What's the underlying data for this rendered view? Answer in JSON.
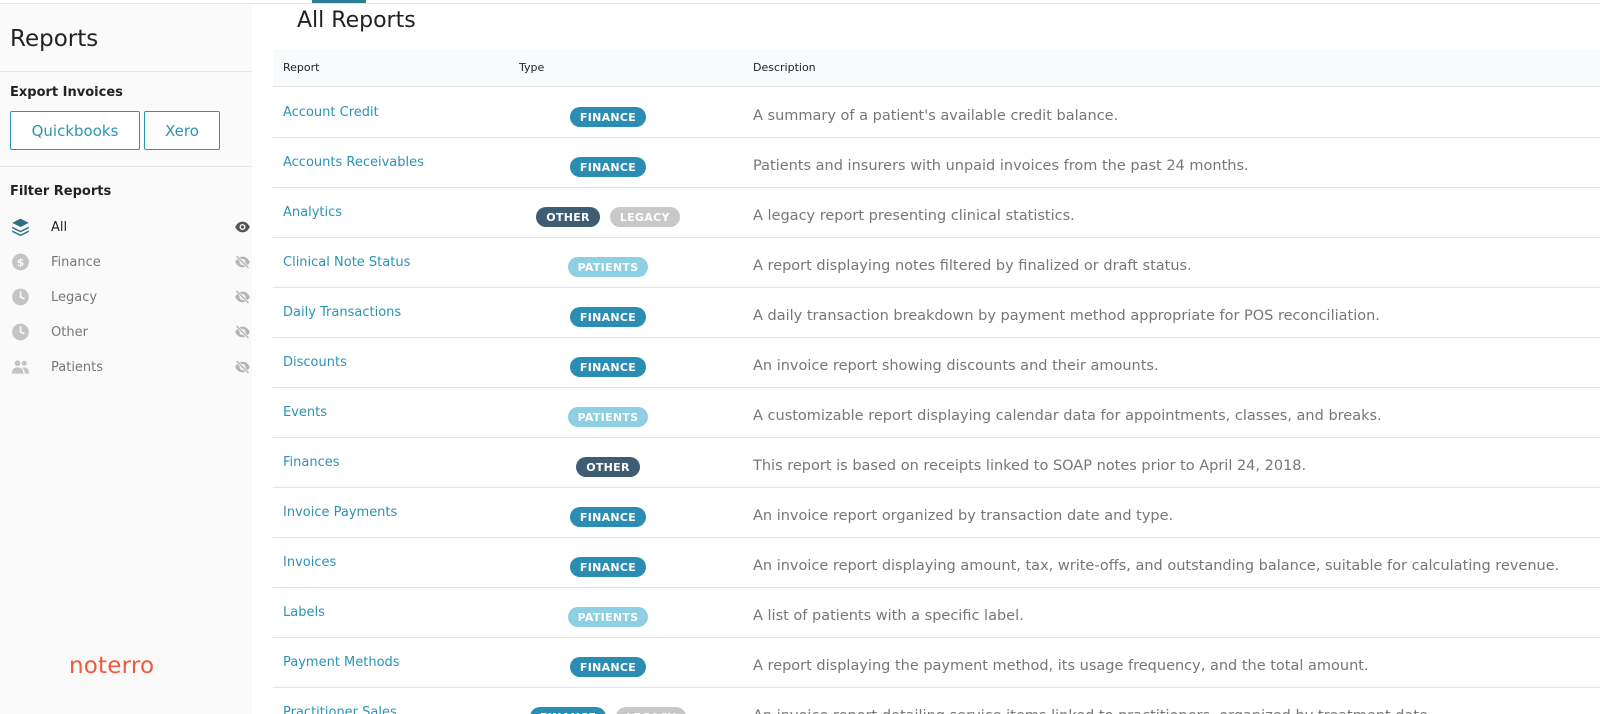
{
  "sidebar": {
    "title": "Reports",
    "export_title": "Export Invoices",
    "export_buttons": [
      "Quickbooks",
      "Xero"
    ],
    "filter_title": "Filter Reports",
    "filters": [
      {
        "label": "All",
        "icon": "layers-icon",
        "active": true
      },
      {
        "label": "Finance",
        "icon": "dollar-icon",
        "active": false
      },
      {
        "label": "Legacy",
        "icon": "clock-icon",
        "active": false
      },
      {
        "label": "Other",
        "icon": "clock-icon",
        "active": false
      },
      {
        "label": "Patients",
        "icon": "people-icon",
        "active": false
      }
    ],
    "logo": "noterro"
  },
  "main": {
    "title": "All Reports",
    "columns": [
      "Report",
      "Type",
      "Description"
    ],
    "rows": [
      {
        "name": "Account Credit",
        "types": [
          "FINANCE"
        ],
        "description": "A summary of a patient's available credit balance."
      },
      {
        "name": "Accounts Receivables",
        "types": [
          "FINANCE"
        ],
        "description": "Patients and insurers with unpaid invoices from the past 24 months."
      },
      {
        "name": "Analytics",
        "types": [
          "OTHER",
          "LEGACY"
        ],
        "description": "A legacy report presenting clinical statistics."
      },
      {
        "name": "Clinical Note Status",
        "types": [
          "PATIENTS"
        ],
        "description": "A report displaying notes filtered by finalized or draft status."
      },
      {
        "name": "Daily Transactions",
        "types": [
          "FINANCE"
        ],
        "description": "A daily transaction breakdown by payment method appropriate for POS reconciliation."
      },
      {
        "name": "Discounts",
        "types": [
          "FINANCE"
        ],
        "description": "An invoice report showing discounts and their amounts."
      },
      {
        "name": "Events",
        "types": [
          "PATIENTS"
        ],
        "description": "A customizable report displaying calendar data for appointments, classes, and breaks."
      },
      {
        "name": "Finances",
        "types": [
          "OTHER"
        ],
        "description": "This report is based on receipts linked to SOAP notes prior to April 24, 2018."
      },
      {
        "name": "Invoice Payments",
        "types": [
          "FINANCE"
        ],
        "description": "An invoice report organized by transaction date and type."
      },
      {
        "name": "Invoices",
        "types": [
          "FINANCE"
        ],
        "description": "An invoice report displaying amount, tax, write-offs, and outstanding balance, suitable for calculating revenue."
      },
      {
        "name": "Labels",
        "types": [
          "PATIENTS"
        ],
        "description": "A list of patients with a specific label."
      },
      {
        "name": "Payment Methods",
        "types": [
          "FINANCE"
        ],
        "description": "A report displaying the payment method, its usage frequency, and the total amount."
      },
      {
        "name": "Practitioner Sales",
        "types": [
          "FINANCE",
          "LEGACY"
        ],
        "description": "An invoice report detailing service items linked to practitioners, organized by treatment date."
      }
    ]
  },
  "colors": {
    "accent": "#2b93b6",
    "finance": "#2b8db3",
    "other": "#3e5d72",
    "legacy": "#c8c8c8",
    "patients": "#8dd0e3",
    "logo": "#f05a3a"
  }
}
